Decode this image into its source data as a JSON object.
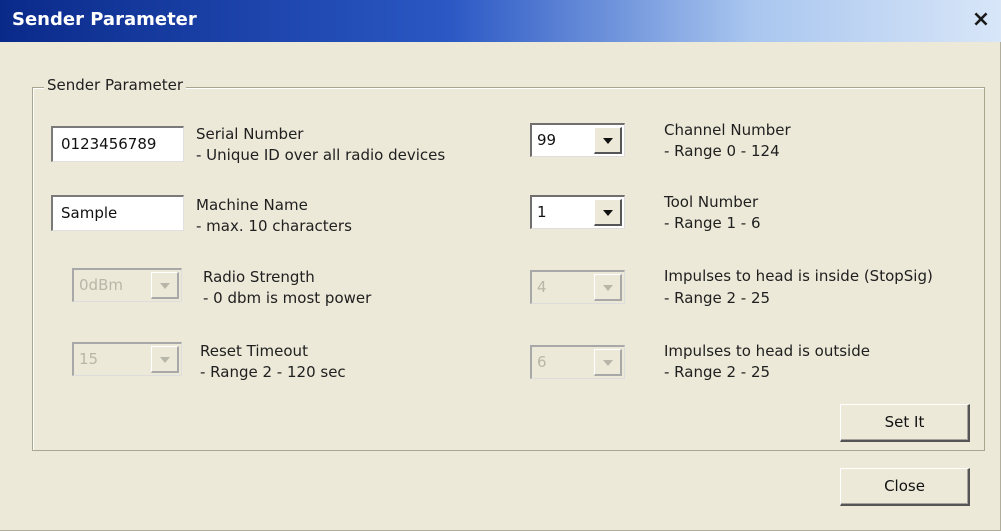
{
  "window": {
    "title": "Sender Parameter",
    "close_glyph": "×"
  },
  "group": {
    "title": "Sender Parameter"
  },
  "left_fields": {
    "serial": {
      "value": "0123456789",
      "label": "Serial Number",
      "hint": " - Unique ID over all radio devices"
    },
    "machine": {
      "value": "Sample",
      "label": "Machine Name",
      "hint": " - max. 10 characters"
    },
    "radio": {
      "value": "0dBm",
      "label": "Radio Strength",
      "hint": " - 0 dbm is most power",
      "enabled": false
    },
    "reset": {
      "value": "15",
      "label": "Reset Timeout",
      "hint": "- Range 2 - 120 sec",
      "enabled": false
    }
  },
  "right_fields": {
    "channel": {
      "value": "99",
      "label": "Channel Number",
      "hint": "- Range  0 - 124"
    },
    "tool": {
      "value": "1",
      "label": "Tool Number",
      "hint": "- Range 1 - 6"
    },
    "impulses_inside": {
      "value": "4",
      "label": "Impulses to head is inside (StopSig)",
      "hint": "- Range  2 - 25",
      "enabled": false
    },
    "impulses_outside": {
      "value": "6",
      "label": "Impulses to head is outside",
      "hint": "- Range 2 - 25",
      "enabled": false
    }
  },
  "buttons": {
    "set_it": "Set It",
    "close": "Close"
  }
}
